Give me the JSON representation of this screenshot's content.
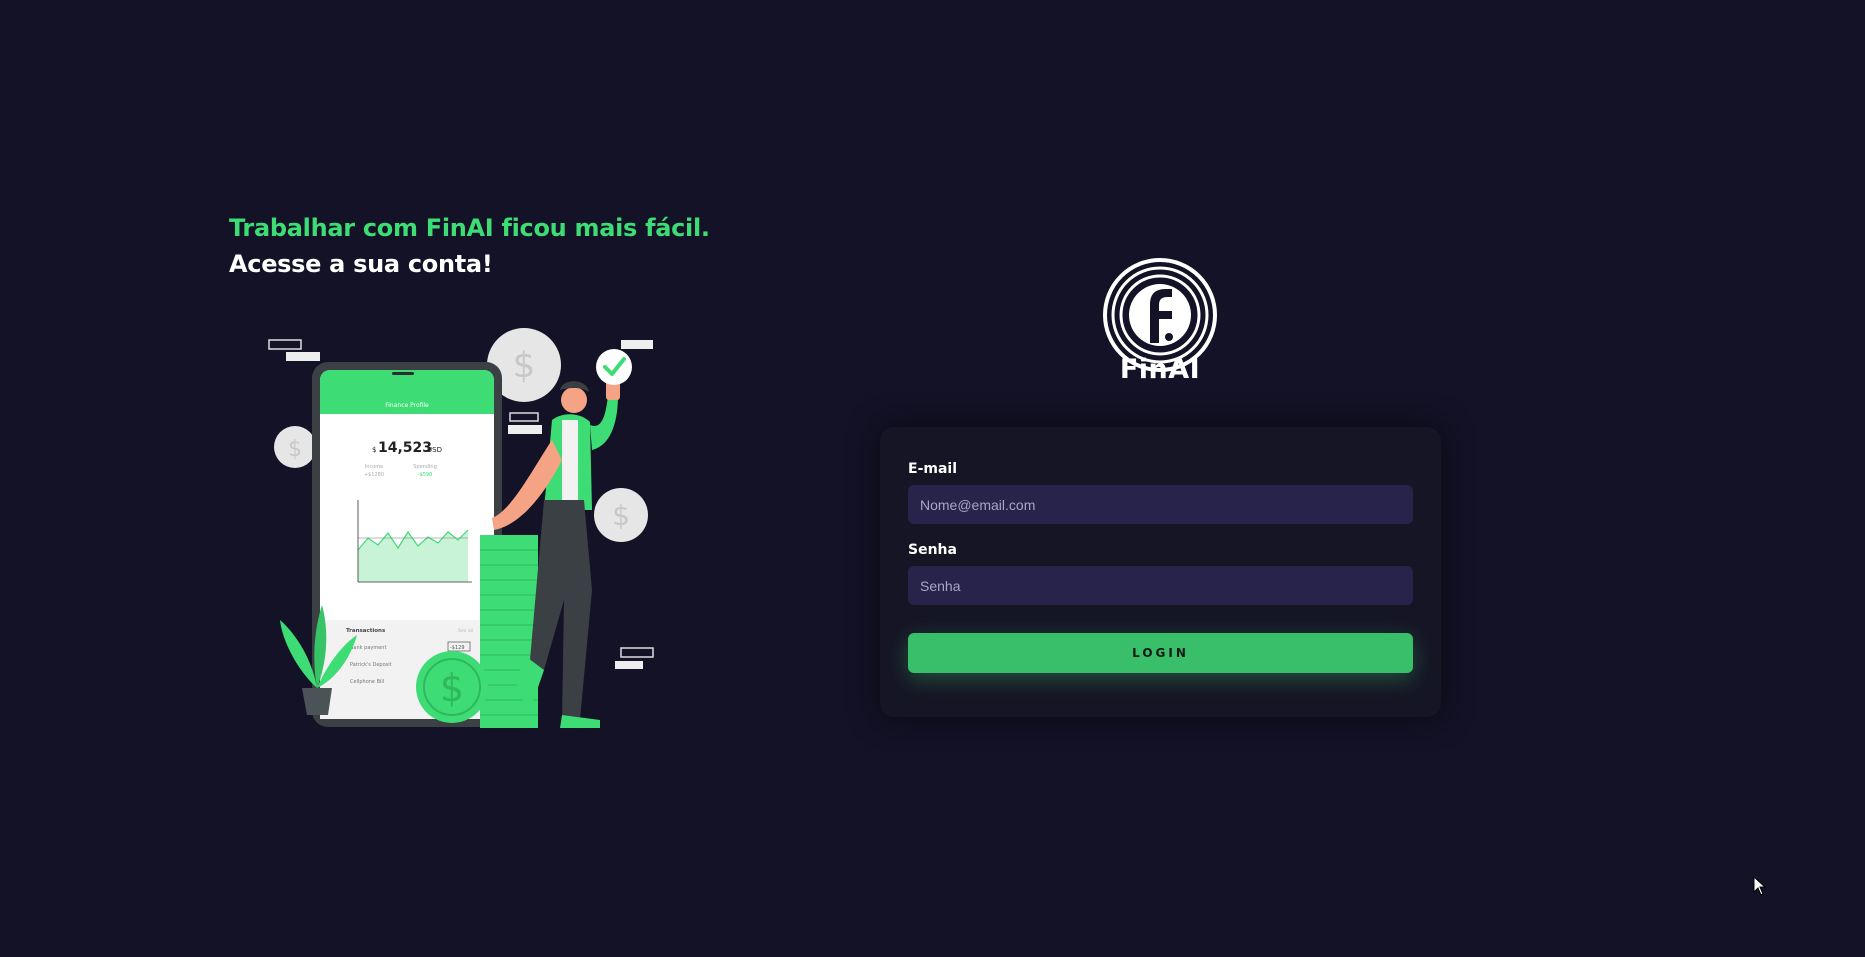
{
  "hero": {
    "line1": "Trabalhar com FinAI ficou mais fácil.",
    "line2": "Acesse a sua conta!"
  },
  "illustration": {
    "phone_title": "Finance Profile",
    "balance_symbol": "$",
    "balance": "14,523",
    "currency": "USD",
    "income_label": "Income",
    "income_value": "+$1280",
    "spending_label": "Spending",
    "spending_value": "-$590",
    "transactions_title": "Transactions",
    "see_all": "See all",
    "tx1": "Bank payment",
    "tx1_value": "-$129",
    "tx2": "Patrick's Deposit",
    "tx3": "Cellphone Bill"
  },
  "brand": {
    "name": "FinAI"
  },
  "form": {
    "email_label": "E-mail",
    "email_placeholder": "Nome@email.com",
    "password_label": "Senha",
    "password_placeholder": "Senha",
    "login_label": "LOGIN"
  },
  "colors": {
    "background": "#131226",
    "accent": "#3ddc74",
    "button": "#39bf69",
    "input": "#27234a"
  }
}
